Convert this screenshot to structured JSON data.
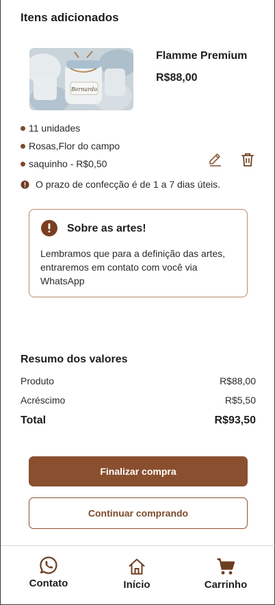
{
  "cart": {
    "title": "Itens adicionados",
    "item": {
      "name": "Flamme Premium",
      "price": "R$88,00",
      "details": [
        "11 unidades",
        "Rosas,Flor do campo",
        "saquinho - R$0,50"
      ]
    },
    "deadline_note": "O prazo de confecção é de 1 a 7 dias úteis."
  },
  "art_notice": {
    "title": "Sobre as artes!",
    "text": "Lembramos que para a definição das artes, entraremos em contato com você via WhatsApp"
  },
  "summary": {
    "title": "Resumo dos valores",
    "rows": [
      {
        "label": "Produto",
        "value": "R$88,00"
      },
      {
        "label": "Acréscimo",
        "value": "R$5,50"
      }
    ],
    "total": {
      "label": "Total",
      "value": "R$93,50"
    }
  },
  "actions": {
    "checkout_label": "Finalizar compra",
    "continue_label": "Continuar comprando"
  },
  "nav": {
    "items": [
      {
        "label": "Contato",
        "icon": "whatsapp-icon"
      },
      {
        "label": "Início",
        "icon": "home-icon"
      },
      {
        "label": "Carrinho",
        "icon": "cart-icon"
      }
    ]
  },
  "colors": {
    "brand": "#8a4f2e",
    "accent_dark": "#7a4a2c",
    "card_border": "#b78a6f"
  }
}
